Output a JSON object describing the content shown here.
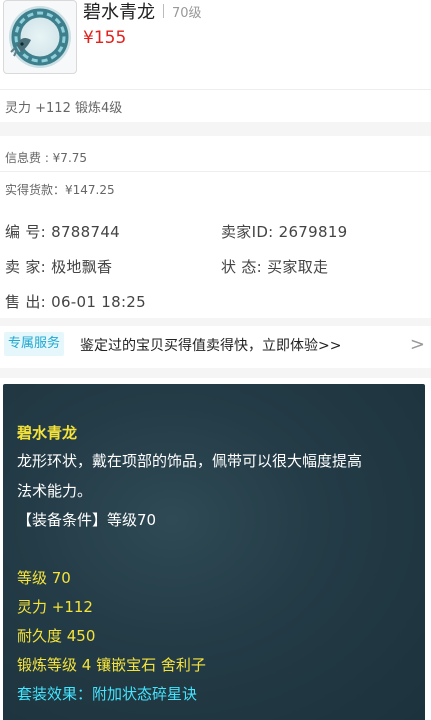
{
  "item": {
    "title": "碧水青龙",
    "level": "70级",
    "price": "¥155",
    "attr_summary": "灵力 +112 锻炼4级"
  },
  "fees": {
    "info_fee": "信息费 : ¥7.75",
    "net_payment": "实得货款：¥147.25"
  },
  "info": {
    "serial_label": "编  号:",
    "serial_value": "8788744",
    "seller_id_label": "卖家ID:",
    "seller_id_value": "2679819",
    "seller_label": "卖  家:",
    "seller_value": "极地飘香",
    "status_label": "状  态:",
    "status_value": "买家取走",
    "sold_label": "售  出:",
    "sold_value": "06-01 18:25"
  },
  "service": {
    "tag": "专属服务",
    "text": "鉴定过的宝贝买得值卖得快，立即体验>>",
    "arrow": ">"
  },
  "detail": {
    "name": "碧水青龙",
    "desc_line1": "龙形环状，戴在项部的饰品，佩带可以很大幅度提高",
    "desc_line2": "法术能力。",
    "requirement": "【装备条件】等级70",
    "stat_level": "等级 70",
    "stat_spirit": "灵力 +112",
    "stat_durability": "耐久度 450",
    "stat_forge": "锻炼等级 4 镶嵌宝石 舍利子",
    "set_effect": "套装效果：附加状态碎星诀"
  },
  "colors": {
    "price": "#e2211c",
    "service_tag": "#1fa8d2",
    "detail_yellow": "#f5e33a",
    "detail_cyan": "#43e5ff",
    "detail_bg": "#243c47"
  },
  "icons": {
    "thumbnail": "jade-dragon-ring-icon",
    "service_arrow": "chevron-right-icon"
  }
}
